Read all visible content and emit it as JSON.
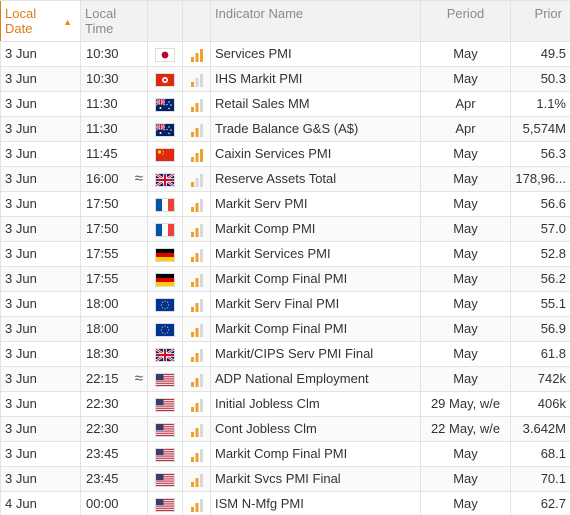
{
  "table": {
    "headers": {
      "date": "Local Date",
      "time": "Local Time",
      "name": "Indicator Name",
      "period": "Period",
      "prior": "Prior"
    },
    "sort_icon": "sort-ascending-icon",
    "colors": {
      "accent": "#e07b1a",
      "volatility": "#f0a030",
      "volatility_dim": "#d8d8d8",
      "header_bg": "#f2f2f2"
    },
    "rows": [
      {
        "date": "3 Jun",
        "time": "10:30",
        "approx": "",
        "country": "Japan",
        "flag": "jp",
        "volatility": "high",
        "name": "Services PMI",
        "period": "May",
        "prior": "49.5"
      },
      {
        "date": "3 Jun",
        "time": "10:30",
        "approx": "",
        "country": "Hong Kong",
        "flag": "hk",
        "volatility": "low",
        "name": "IHS Markit PMI",
        "period": "May",
        "prior": "50.3"
      },
      {
        "date": "3 Jun",
        "time": "11:30",
        "approx": "",
        "country": "Australia",
        "flag": "au",
        "volatility": "medium",
        "name": "Retail Sales MM",
        "period": "Apr",
        "prior": "1.1%"
      },
      {
        "date": "3 Jun",
        "time": "11:30",
        "approx": "",
        "country": "Australia",
        "flag": "au",
        "volatility": "medium",
        "name": "Trade Balance G&S (A$)",
        "period": "Apr",
        "prior": "5,574M"
      },
      {
        "date": "3 Jun",
        "time": "11:45",
        "approx": "",
        "country": "China",
        "flag": "cn",
        "volatility": "high",
        "name": "Caixin Services PMI",
        "period": "May",
        "prior": "56.3"
      },
      {
        "date": "3 Jun",
        "time": "16:00",
        "approx": "≈",
        "country": "United Kingdom",
        "flag": "gb",
        "volatility": "low",
        "name": "Reserve Assets Total",
        "period": "May",
        "prior": "178,96..."
      },
      {
        "date": "3 Jun",
        "time": "17:50",
        "approx": "",
        "country": "France",
        "flag": "fr",
        "volatility": "medium",
        "name": "Markit Serv PMI",
        "period": "May",
        "prior": "56.6"
      },
      {
        "date": "3 Jun",
        "time": "17:50",
        "approx": "",
        "country": "France",
        "flag": "fr",
        "volatility": "medium",
        "name": "Markit Comp PMI",
        "period": "May",
        "prior": "57.0"
      },
      {
        "date": "3 Jun",
        "time": "17:55",
        "approx": "",
        "country": "Germany",
        "flag": "de",
        "volatility": "medium",
        "name": "Markit Services PMI",
        "period": "May",
        "prior": "52.8"
      },
      {
        "date": "3 Jun",
        "time": "17:55",
        "approx": "",
        "country": "Germany",
        "flag": "de",
        "volatility": "medium",
        "name": "Markit Comp Final PMI",
        "period": "May",
        "prior": "56.2"
      },
      {
        "date": "3 Jun",
        "time": "18:00",
        "approx": "",
        "country": "Euro Zone",
        "flag": "eu",
        "volatility": "medium",
        "name": "Markit Serv Final PMI",
        "period": "May",
        "prior": "55.1"
      },
      {
        "date": "3 Jun",
        "time": "18:00",
        "approx": "",
        "country": "Euro Zone",
        "flag": "eu",
        "volatility": "medium",
        "name": "Markit Comp Final PMI",
        "period": "May",
        "prior": "56.9"
      },
      {
        "date": "3 Jun",
        "time": "18:30",
        "approx": "",
        "country": "United Kingdom",
        "flag": "gb",
        "volatility": "medium",
        "name": "Markit/CIPS Serv PMI Final",
        "period": "May",
        "prior": "61.8"
      },
      {
        "date": "3 Jun",
        "time": "22:15",
        "approx": "≈",
        "country": "United States",
        "flag": "us",
        "volatility": "medium",
        "name": "ADP National Employment",
        "period": "May",
        "prior": "742k"
      },
      {
        "date": "3 Jun",
        "time": "22:30",
        "approx": "",
        "country": "United States",
        "flag": "us",
        "volatility": "medium",
        "name": "Initial Jobless Clm",
        "period": "29 May, w/e",
        "prior": "406k"
      },
      {
        "date": "3 Jun",
        "time": "22:30",
        "approx": "",
        "country": "United States",
        "flag": "us",
        "volatility": "medium",
        "name": "Cont Jobless Clm",
        "period": "22 May, w/e",
        "prior": "3.642M"
      },
      {
        "date": "3 Jun",
        "time": "23:45",
        "approx": "",
        "country": "United States",
        "flag": "us",
        "volatility": "medium",
        "name": "Markit Comp Final PMI",
        "period": "May",
        "prior": "68.1"
      },
      {
        "date": "3 Jun",
        "time": "23:45",
        "approx": "",
        "country": "United States",
        "flag": "us",
        "volatility": "medium",
        "name": "Markit Svcs PMI Final",
        "period": "May",
        "prior": "70.1"
      },
      {
        "date": "4 Jun",
        "time": "00:00",
        "approx": "",
        "country": "United States",
        "flag": "us",
        "volatility": "medium",
        "name": "ISM N-Mfg PMI",
        "period": "May",
        "prior": "62.7"
      }
    ]
  }
}
